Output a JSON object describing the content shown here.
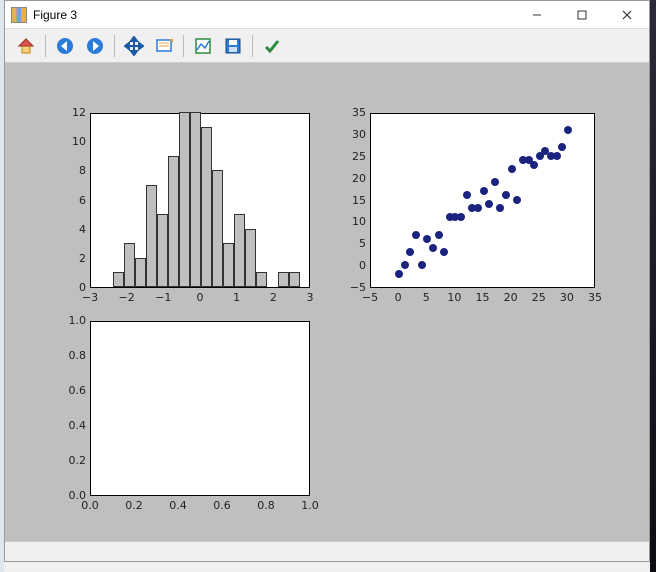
{
  "window": {
    "title": "Figure 3"
  },
  "toolbar": {
    "home": "Home",
    "back": "Back",
    "forward": "Forward",
    "pan": "Pan",
    "zoom": "Zoom",
    "subplots": "Configure subplots",
    "save": "Save",
    "ok": "Apply"
  },
  "yticks1": [
    "12",
    "10",
    "8",
    "6",
    "4",
    "2",
    "0"
  ],
  "xticks1": [
    "−3",
    "−2",
    "−1",
    "0",
    "1",
    "2",
    "3"
  ],
  "yticks2": [
    "35",
    "30",
    "25",
    "20",
    "15",
    "10",
    "5",
    "0",
    "−5"
  ],
  "xticks2": [
    "−5",
    "0",
    "5",
    "10",
    "15",
    "20",
    "25",
    "30",
    "35"
  ],
  "yticks3": [
    "1.0",
    "0.8",
    "0.6",
    "0.4",
    "0.2",
    "0.0"
  ],
  "xticks3": [
    "0.0",
    "0.2",
    "0.4",
    "0.6",
    "0.8",
    "1.0"
  ],
  "chart_data": [
    {
      "type": "bar",
      "title": "",
      "xlabel": "",
      "ylabel": "",
      "xlim": [
        -3,
        3
      ],
      "ylim": [
        0,
        12
      ],
      "bin_width": 0.3,
      "bin_left_edges": [
        -2.4,
        -2.1,
        -1.8,
        -1.5,
        -1.2,
        -0.9,
        -0.6,
        -0.3,
        0.0,
        0.3,
        0.6,
        0.9,
        1.2,
        1.5,
        1.8,
        2.1,
        2.4
      ],
      "counts": [
        1,
        3,
        2,
        7,
        5,
        9,
        12,
        12,
        11,
        8,
        3,
        5,
        4,
        1,
        0,
        1,
        1
      ]
    },
    {
      "type": "scatter",
      "title": "",
      "xlabel": "",
      "ylabel": "",
      "xlim": [
        -5,
        35
      ],
      "ylim": [
        -5,
        35
      ],
      "x": [
        0,
        1,
        2,
        3,
        4,
        5,
        6,
        7,
        8,
        9,
        10,
        11,
        12,
        13,
        14,
        15,
        16,
        17,
        18,
        19,
        20,
        21,
        22,
        23,
        24,
        25,
        26,
        27,
        28,
        29,
        30
      ],
      "y": [
        -2,
        0,
        3,
        7,
        0,
        6,
        4,
        7,
        3,
        11,
        11,
        11,
        16,
        13,
        13,
        17,
        14,
        19,
        13,
        16,
        22,
        15,
        24,
        24,
        23,
        25,
        26,
        25,
        25,
        27,
        31
      ]
    },
    {
      "type": "line",
      "title": "",
      "xlabel": "",
      "ylabel": "",
      "xlim": [
        0.0,
        1.0
      ],
      "ylim": [
        0.0,
        1.0
      ],
      "x": [],
      "y": []
    }
  ]
}
